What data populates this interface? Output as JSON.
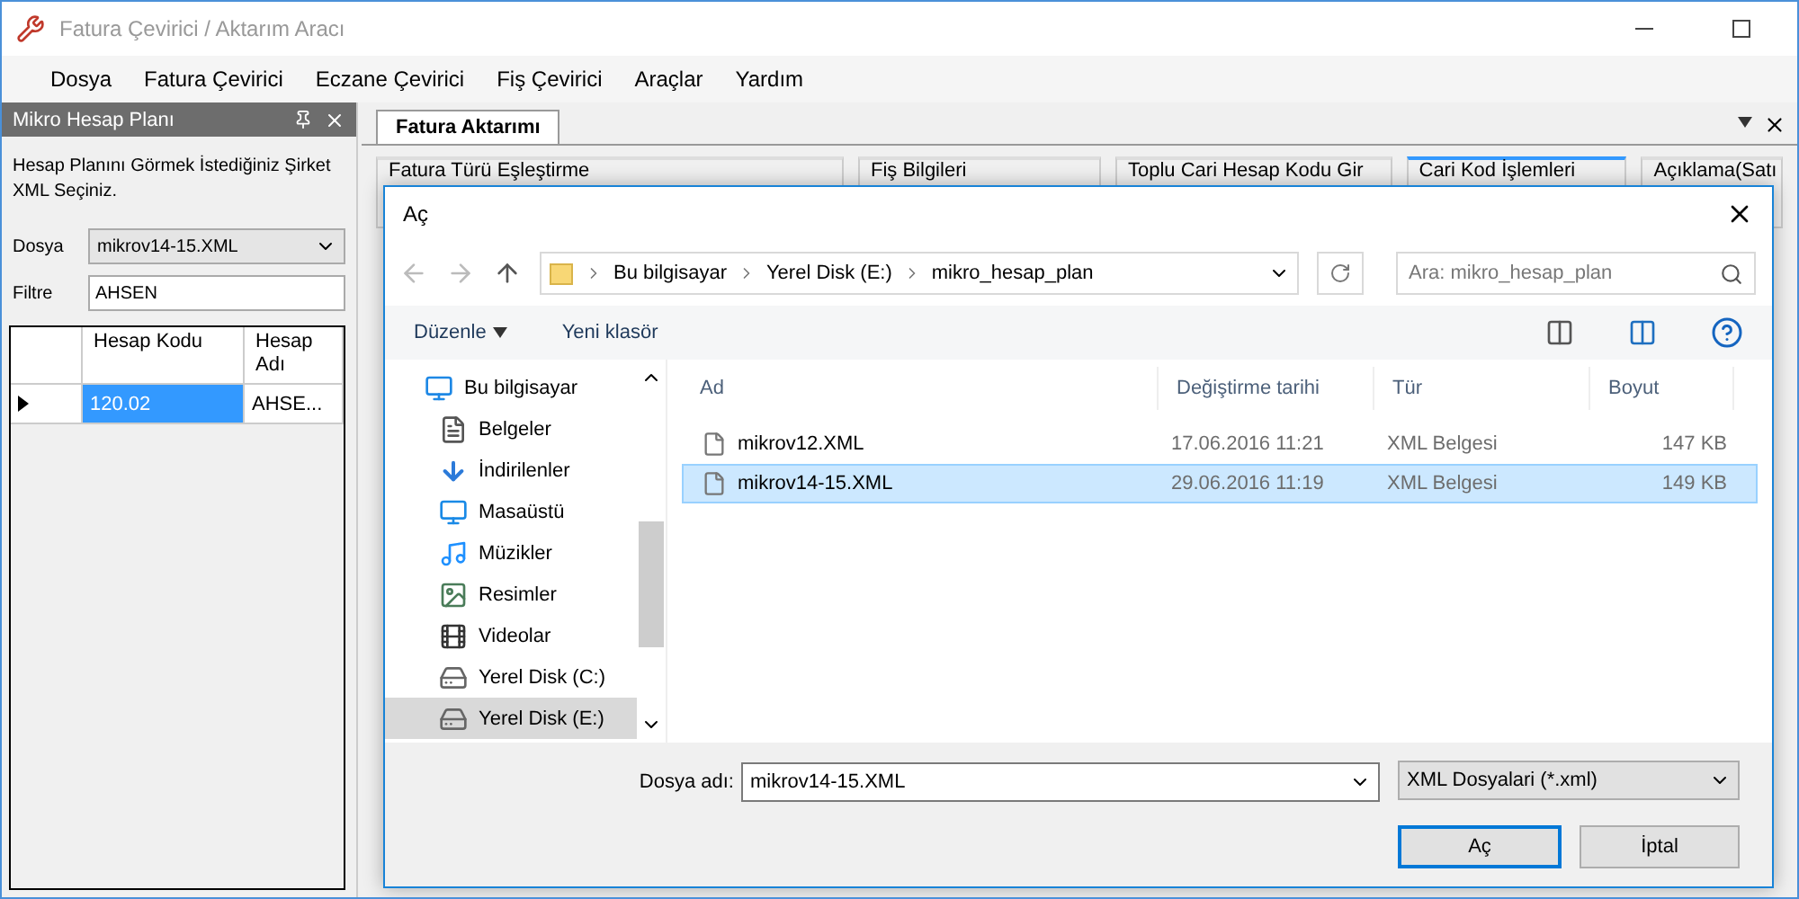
{
  "window": {
    "title": "Fatura Çevirici / Aktarım Aracı"
  },
  "menu": [
    "Dosya",
    "Fatura Çevirici",
    "Eczane Çevirici",
    "Fiş Çevirici",
    "Araçlar",
    "Yardım"
  ],
  "left_panel": {
    "title": "Mikro Hesap Planı",
    "hint": "Hesap Planını Görmek İstediğiniz Şirket XML Seçiniz.",
    "file_label": "Dosya",
    "file_value": "mikrov14-15.XML",
    "filter_label": "Filtre",
    "filter_value": "AHSEN",
    "table": {
      "columns": [
        "Hesap Kodu",
        "Hesap Adı"
      ],
      "rows": [
        {
          "cells": [
            "120.02",
            "AHSE..."
          ],
          "selected": true
        }
      ]
    }
  },
  "doc_tabs": [
    {
      "label": "Fatura Aktarımı",
      "selected": true
    }
  ],
  "groups": [
    {
      "title": "Fatura Türü Eşleştirme",
      "selected": false
    },
    {
      "title": "Fiş Bilgileri",
      "selected": false
    },
    {
      "title": "Toplu Cari Hesap Kodu Gir",
      "selected": false
    },
    {
      "title": "Cari Kod İşlemleri",
      "selected": true
    },
    {
      "title": "Açıklama(Satı",
      "selected": false
    }
  ],
  "dialog": {
    "title": "Aç",
    "path": [
      "Bu bilgisayar",
      "Yerel Disk (E:)",
      "mikro_hesap_plan"
    ],
    "search": {
      "placeholder": "Ara: mikro_hesap_plan"
    },
    "toolbar": [
      "Düzenle",
      "Yeni klasör"
    ],
    "nav": [
      {
        "label": "Bu bilgisayar",
        "kind": "pc",
        "selected": false
      },
      {
        "label": "Belgeler",
        "kind": "docs",
        "selected": false
      },
      {
        "label": "İndirilenler",
        "kind": "download",
        "selected": false
      },
      {
        "label": "Masaüstü",
        "kind": "desktop",
        "selected": false
      },
      {
        "label": "Müzikler",
        "kind": "music",
        "selected": false
      },
      {
        "label": "Resimler",
        "kind": "pictures",
        "selected": false
      },
      {
        "label": "Videolar",
        "kind": "videos",
        "selected": false
      },
      {
        "label": "Yerel Disk (C:)",
        "kind": "drive",
        "selected": false
      },
      {
        "label": "Yerel Disk (E:)",
        "kind": "drive",
        "selected": true
      }
    ],
    "columns": [
      "Ad",
      "Değiştirme tarihi",
      "Tür",
      "Boyut"
    ],
    "files": [
      {
        "name": "mikrov12.XML",
        "date": "17.06.2016 11:21",
        "type": "XML Belgesi",
        "size": "147 KB",
        "selected": false
      },
      {
        "name": "mikrov14-15.XML",
        "date": "29.06.2016 11:19",
        "type": "XML Belgesi",
        "size": "149 KB",
        "selected": true
      }
    ],
    "filename_label": "Dosya adı:",
    "filename": "mikrov14-15.XML",
    "filetype": "XML Dosyalari (*.xml)",
    "buttons": [
      "Aç",
      "İptal"
    ]
  }
}
